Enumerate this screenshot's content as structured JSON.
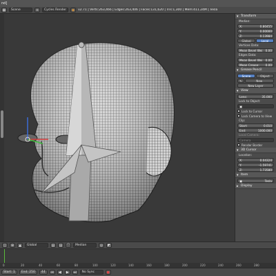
{
  "window": {
    "title_suffix": "nd]"
  },
  "info_header": {
    "scene": "Scene",
    "render_engine": "Cycles Render",
    "stats": "v2.71 | Verts:263,466 | Edges:263,406 | Faces:131,620 | Tris:1,300 | Mem:411.24M | Tesla"
  },
  "npanel": {
    "transform": {
      "title": "Transform",
      "median_label": "Median:",
      "x_label": "X:",
      "x_value": "0.80455",
      "y_label": "Y:",
      "y_value": "0.00000",
      "z_label": "Z:",
      "z_value": "0.13984",
      "global": "Global",
      "local": "Local",
      "vertices_data_label": "Vertices Data:",
      "mean_bevel_weight_1": "Mean Bevel Wei",
      "mean_bevel_weight_1_value": "0.00",
      "edges_data_label": "Edges Data:",
      "mean_bevel_weight_2": "Mean Bevel Wei",
      "mean_bevel_weight_2_value": "0.00",
      "mean_crease": "Mean Crease:",
      "mean_crease_value": "0.00"
    },
    "grease_pencil": {
      "title": "Grease Pencil",
      "scene": "Scene",
      "object": "Object",
      "new": "New",
      "new_layer": "New Layer"
    },
    "view": {
      "title": "View",
      "lens_label": "Lens:",
      "lens_value": "35.000",
      "lock_to_object": "Lock to Object:",
      "lock_to_cursor": "Lock to Cursor",
      "lock_camera_to_view": "Lock Camera to View",
      "clip_label": "Clip:",
      "clip_start_label": "Start:",
      "clip_start_value": "0.010",
      "clip_end_label": "End:",
      "clip_end_value": "1000.000",
      "local_camera_label": "Local Camera:",
      "camera": "Camera",
      "render_border": "Render Border"
    },
    "cursor_3d": {
      "title": "3D Cursor",
      "location_label": "Location:",
      "x_label": "X:",
      "x_value": "0.04324",
      "y_label": "Y:",
      "y_value": "-1.59741",
      "z_label": "Z:",
      "z_value": "1.73580"
    },
    "item": {
      "title": "Item",
      "name": "Tesla"
    },
    "display": {
      "title": "Display"
    }
  },
  "view_header": {
    "mode": "Global",
    "pivot": "Median"
  },
  "timeline": {
    "ticks": [
      "0",
      "20",
      "40",
      "60",
      "80",
      "100",
      "120",
      "140",
      "160",
      "180",
      "200",
      "220",
      "240",
      "260",
      "280"
    ],
    "start_label": "Start: 1",
    "end_label": "End: 250",
    "current_frame": "44",
    "sync": "No Sync"
  },
  "colors": {
    "accent": "#5680c2",
    "frame_marker": "#5bbd3c",
    "mesh": "#d9d9d9"
  }
}
